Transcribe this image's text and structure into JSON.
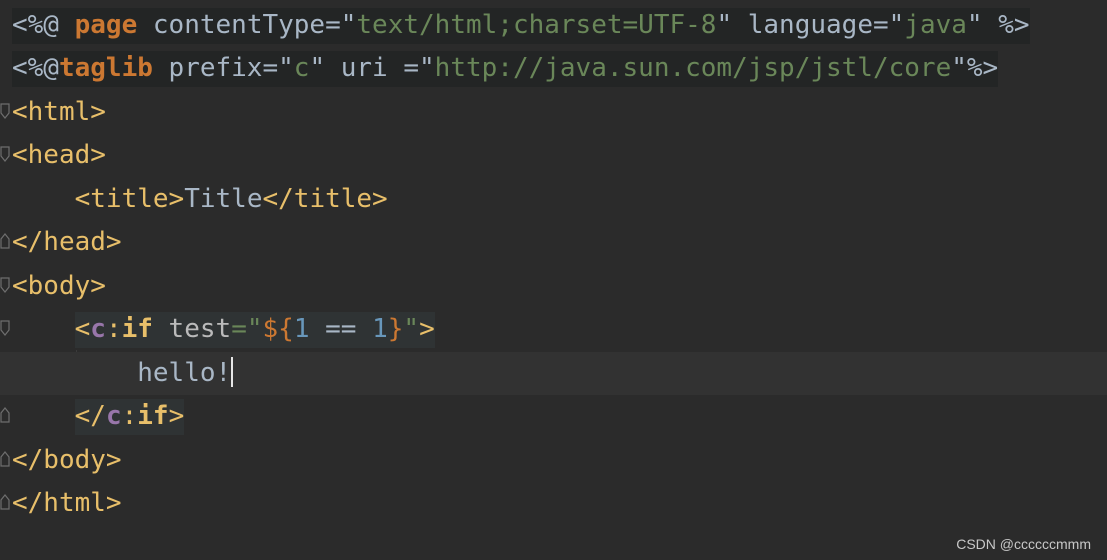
{
  "editor": {
    "lines": [
      {
        "tokens": [
          {
            "text": "<%@ ",
            "kind": "plain"
          },
          {
            "text": "page",
            "kind": "kw"
          },
          {
            "text": " contentType",
            "kind": "plain"
          },
          {
            "text": "=\"",
            "kind": "plain"
          },
          {
            "text": "text/html;charset=UTF-8",
            "kind": "str"
          },
          {
            "text": "\" language",
            "kind": "plain"
          },
          {
            "text": "=\"",
            "kind": "plain"
          },
          {
            "text": "java",
            "kind": "str"
          },
          {
            "text": "\" %>",
            "kind": "plain"
          }
        ]
      },
      {
        "tokens": [
          {
            "text": "<%@",
            "kind": "plain"
          },
          {
            "text": "taglib",
            "kind": "kw"
          },
          {
            "text": " prefix",
            "kind": "plain"
          },
          {
            "text": "=\"",
            "kind": "plain"
          },
          {
            "text": "c",
            "kind": "str"
          },
          {
            "text": "\" uri ",
            "kind": "plain"
          },
          {
            "text": "=\"",
            "kind": "plain"
          },
          {
            "text": "http://java.sun.com/jsp/jstl/core",
            "kind": "str"
          },
          {
            "text": "\"%>",
            "kind": "plain"
          }
        ]
      },
      {
        "tokens": [
          {
            "text": "<html>",
            "kind": "tag"
          }
        ]
      },
      {
        "tokens": [
          {
            "text": "<head>",
            "kind": "tag"
          }
        ]
      },
      {
        "tokens": [
          {
            "text": "    ",
            "kind": "plain"
          },
          {
            "text": "<title>",
            "kind": "tag"
          },
          {
            "text": "Title",
            "kind": "plain"
          },
          {
            "text": "</title>",
            "kind": "tag"
          }
        ]
      },
      {
        "tokens": [
          {
            "text": "</head>",
            "kind": "tag"
          }
        ]
      },
      {
        "tokens": [
          {
            "text": "<body>",
            "kind": "tag"
          }
        ]
      },
      {
        "tokens": [
          {
            "text": "    ",
            "kind": "plain"
          },
          {
            "text": "<",
            "kind": "tag"
          },
          {
            "text": "c",
            "kind": "ns"
          },
          {
            "text": ":",
            "kind": "tag"
          },
          {
            "text": "if",
            "kind": "el"
          },
          {
            "text": " test",
            "kind": "attr"
          },
          {
            "text": "=\"",
            "kind": "str"
          },
          {
            "text": "${",
            "kind": "dollar"
          },
          {
            "text": "1",
            "kind": "num"
          },
          {
            "text": " == ",
            "kind": "op"
          },
          {
            "text": "1",
            "kind": "num"
          },
          {
            "text": "}",
            "kind": "dollar"
          },
          {
            "text": "\"",
            "kind": "str"
          },
          {
            "text": ">",
            "kind": "tag"
          }
        ]
      },
      {
        "tokens": [
          {
            "text": "        ",
            "kind": "plain"
          },
          {
            "text": "hello!",
            "kind": "plain"
          }
        ]
      },
      {
        "tokens": [
          {
            "text": "    ",
            "kind": "plain"
          },
          {
            "text": "</",
            "kind": "tag"
          },
          {
            "text": "c",
            "kind": "ns"
          },
          {
            "text": ":",
            "kind": "tag"
          },
          {
            "text": "if",
            "kind": "el"
          },
          {
            "text": ">",
            "kind": "tag"
          }
        ]
      },
      {
        "tokens": [
          {
            "text": "</body>",
            "kind": "tag"
          }
        ]
      },
      {
        "tokens": [
          {
            "text": "</html>",
            "kind": "tag"
          }
        ]
      }
    ],
    "current_line_index": 8
  },
  "watermark": "CSDN @ccccccmmm",
  "colors": {
    "background": "#2b2b2b",
    "current_line": "#323232",
    "tag": "#e8bf6a",
    "keyword": "#cc7832",
    "string": "#6a8759",
    "number": "#6897bb",
    "namespace": "#9876aa",
    "plain": "#a9b7c6"
  },
  "icons": {
    "fold_open": "fold-open-icon",
    "fold_close": "fold-close-icon"
  }
}
